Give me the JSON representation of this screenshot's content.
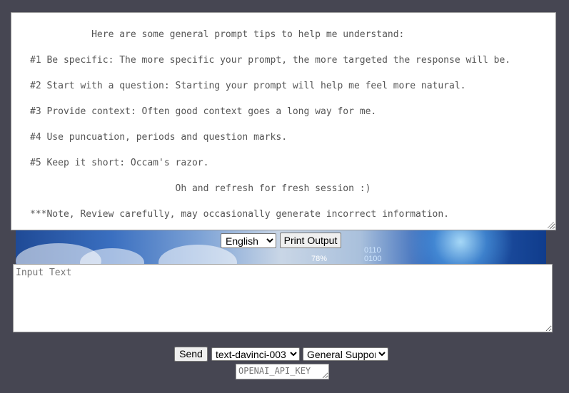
{
  "output": {
    "lines": [
      "           Here are some general prompt tips to help me understand:",
      "#1 Be specific: The more specific your prompt, the more targeted the response will be.",
      "#2 Start with a question: Starting your prompt will help me feel more natural.",
      "#3 Provide context: Often good context goes a long way for me.",
      "#4 Use puncuation, periods and question marks.",
      "#5 Keep it short: Occam's razor.",
      "                          Oh and refresh for fresh session :)",
      "***Note, Review carefully, may occasionally generate incorrect information."
    ]
  },
  "banner": {
    "text_a": "0110",
    "text_b": "0100",
    "text_c": "78%"
  },
  "controls": {
    "language_selected": "English",
    "print_label": "Print Output",
    "input_placeholder": "Input Text",
    "send_label": "Send",
    "model_selected": "text-davinci-003",
    "mode_selected": "General Support",
    "apikey_placeholder": "OPENAI_API_KEY"
  }
}
